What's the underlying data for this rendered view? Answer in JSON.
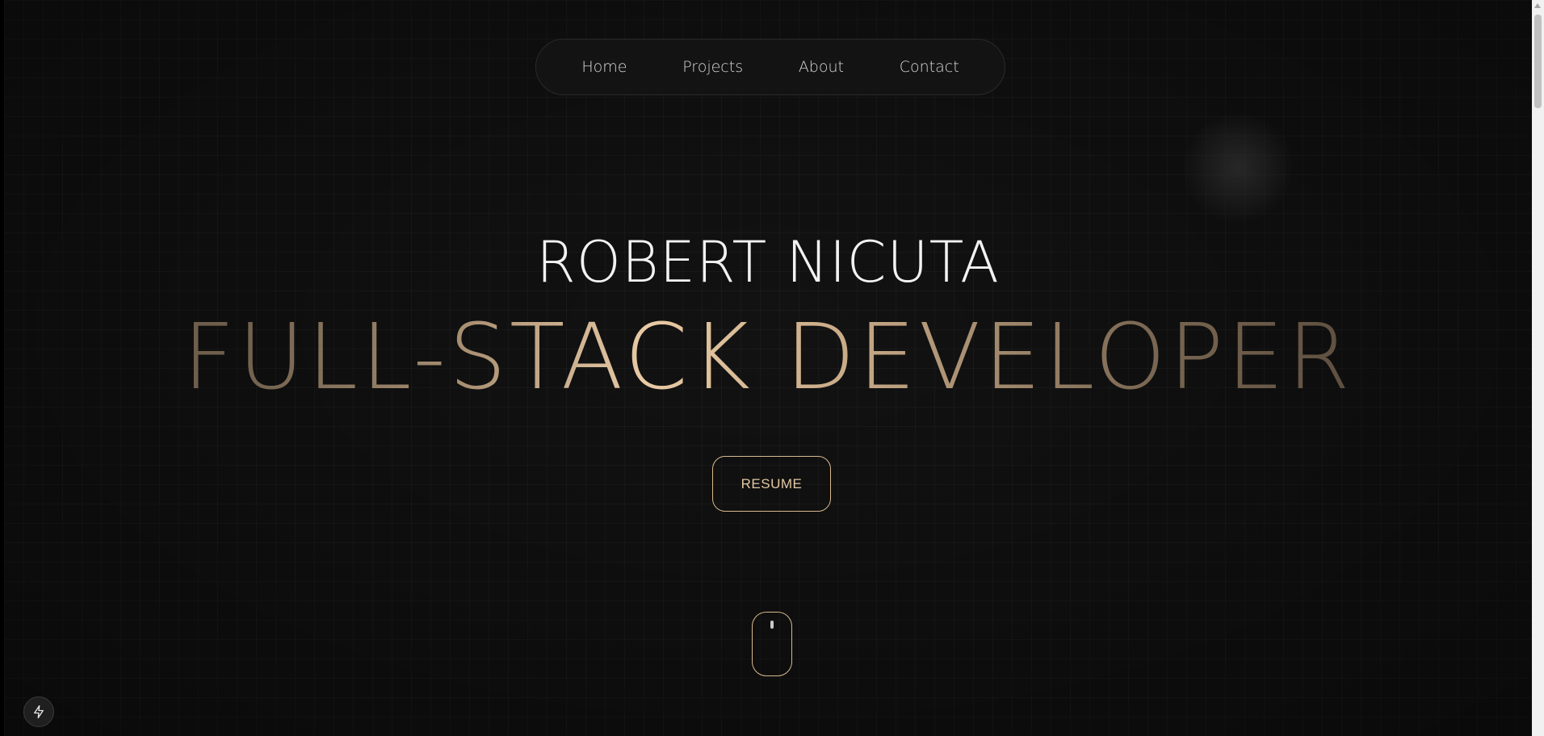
{
  "nav": {
    "items": [
      {
        "label": "Home"
      },
      {
        "label": "Projects"
      },
      {
        "label": "About"
      },
      {
        "label": "Contact"
      }
    ]
  },
  "hero": {
    "name": "ROBERT NICUTA",
    "role": "FULL-STACK DEVELOPER",
    "resume_label": "RESUME"
  },
  "icons": {
    "scroll_indicator": "mouse-icon",
    "floating_button": "bolt-icon"
  },
  "colors": {
    "background": "#121212",
    "accent": "#d9b98f",
    "name_text": "#f2f2f2"
  }
}
